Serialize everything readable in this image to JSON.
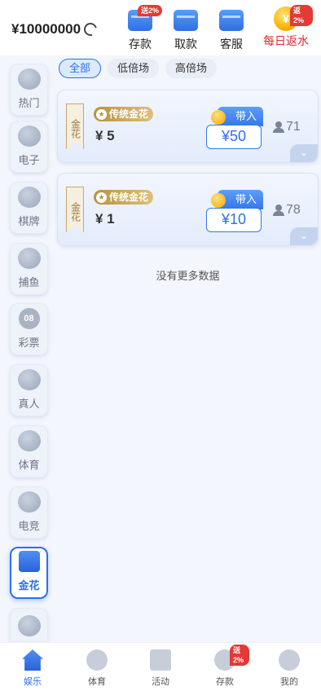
{
  "header": {
    "balance": "¥10000000",
    "icons": [
      {
        "label": "存款",
        "icon": "deposit-icon",
        "badge": "送2%"
      },
      {
        "label": "取款",
        "icon": "withdraw-icon",
        "badge": ""
      },
      {
        "label": "客服",
        "icon": "service-icon",
        "badge": ""
      },
      {
        "label": "每日返水",
        "icon": "rebate-coin-icon",
        "badge": "返2%"
      }
    ]
  },
  "sidebar": {
    "items": [
      {
        "label": "热门",
        "icon": "flame-icon"
      },
      {
        "label": "电子",
        "icon": "gamepad-icon"
      },
      {
        "label": "棋牌",
        "icon": "cards-icon"
      },
      {
        "label": "捕鱼",
        "icon": "fish-icon"
      },
      {
        "label": "彩票",
        "icon": "lottery-ball-icon",
        "icon_text": "08"
      },
      {
        "label": "真人",
        "icon": "dice-icon"
      },
      {
        "label": "体育",
        "icon": "soccer-ball-icon"
      },
      {
        "label": "电竞",
        "icon": "esports-icon"
      },
      {
        "label": "金花",
        "icon": "poker-icon",
        "active": true
      },
      {
        "label": "",
        "icon": "more-cards-icon"
      }
    ]
  },
  "tabs": [
    "全部",
    "低倍场",
    "高倍场"
  ],
  "rooms": [
    {
      "ribbon": "金花",
      "tag": "传统金花",
      "base": "¥ 5",
      "enter_label": "带入",
      "enter_amount": "¥50",
      "online": "71"
    },
    {
      "ribbon": "金花",
      "tag": "传统金花",
      "base": "¥ 1",
      "enter_label": "带入",
      "enter_amount": "¥10",
      "online": "78"
    }
  ],
  "no_more_text": "没有更多数据",
  "bottom_nav": [
    {
      "label": "娱乐",
      "icon": "home-icon",
      "active": true
    },
    {
      "label": "体育",
      "icon": "soccer-ball-icon"
    },
    {
      "label": "活动",
      "icon": "gift-icon"
    },
    {
      "label": "存款",
      "icon": "money-bag-icon",
      "badge": "送2%"
    },
    {
      "label": "我的",
      "icon": "profile-icon"
    }
  ],
  "colors": {
    "accent": "#2f6fe8",
    "badge": "#e53935",
    "gold": "#b8923f"
  }
}
